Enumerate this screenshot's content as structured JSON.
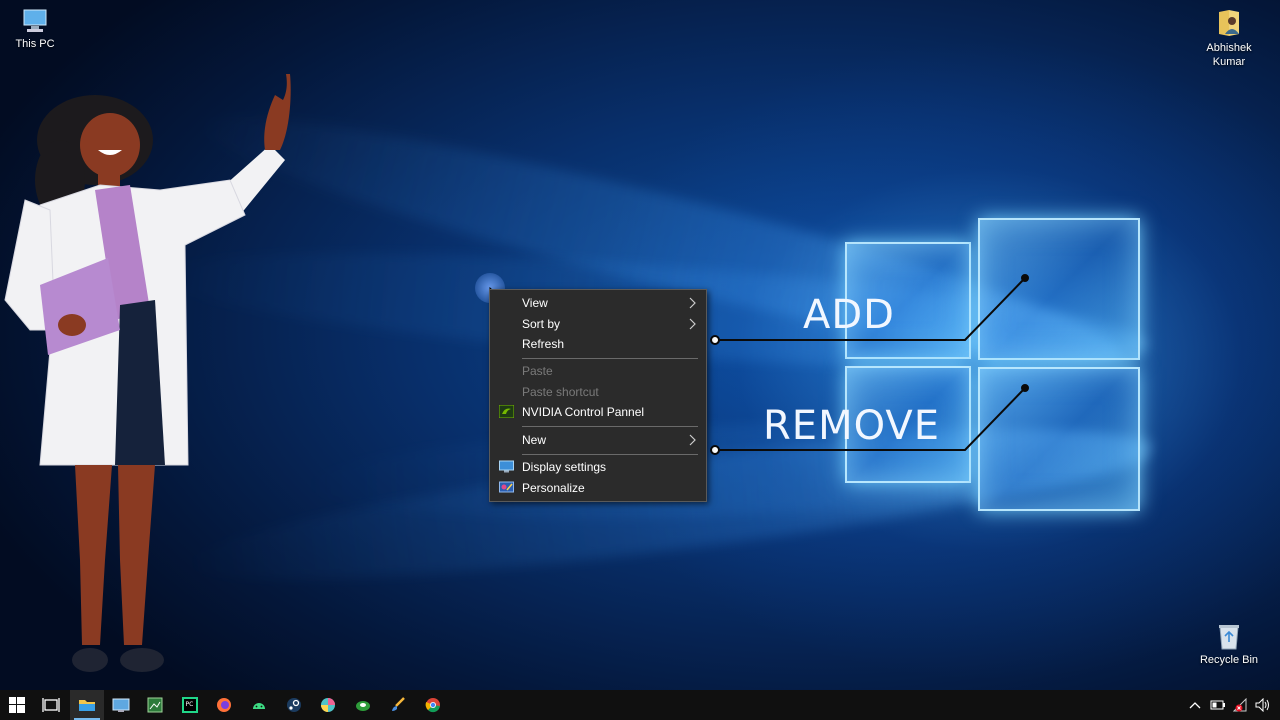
{
  "desktop": {
    "icons": [
      {
        "label": "This PC",
        "icon": "computer-icon"
      },
      {
        "label": "Abhishek Kumar",
        "icon": "user-folder-icon"
      },
      {
        "label": "Recycle Bin",
        "icon": "recycle-bin-icon"
      }
    ],
    "overlay": {
      "add_label": "ADD",
      "remove_label": "REMOVE"
    }
  },
  "context_menu": {
    "items": [
      {
        "label": "View",
        "submenu": true,
        "enabled": true
      },
      {
        "label": "Sort by",
        "submenu": true,
        "enabled": true
      },
      {
        "label": "Refresh",
        "enabled": true
      },
      {
        "label": "Paste",
        "enabled": false
      },
      {
        "label": "Paste shortcut",
        "enabled": false
      },
      {
        "label": "NVIDIA Control Pannel",
        "icon": "nvidia-icon",
        "enabled": true
      },
      {
        "label": "New",
        "submenu": true,
        "enabled": true
      },
      {
        "label": "Display settings",
        "icon": "display-icon",
        "enabled": true
      },
      {
        "label": "Personalize",
        "icon": "personalize-icon",
        "enabled": true
      }
    ]
  },
  "taskbar": {
    "apps": [
      "start-icon",
      "task-view-icon",
      "file-explorer-icon",
      "control-panel-icon",
      "image-viewer-icon",
      "pycharm-icon",
      "firefox-icon",
      "android-studio-icon",
      "steam-icon",
      "browser-icon",
      "xbox-icon",
      "brush-icon",
      "chrome-icon"
    ],
    "tray": [
      "show-hidden-icons-icon",
      "battery-icon",
      "network-icon",
      "volume-icon"
    ]
  },
  "colors": {
    "menu_bg": "#2b2b2b",
    "taskbar_bg": "#101010",
    "accent": "#76b9ed"
  }
}
